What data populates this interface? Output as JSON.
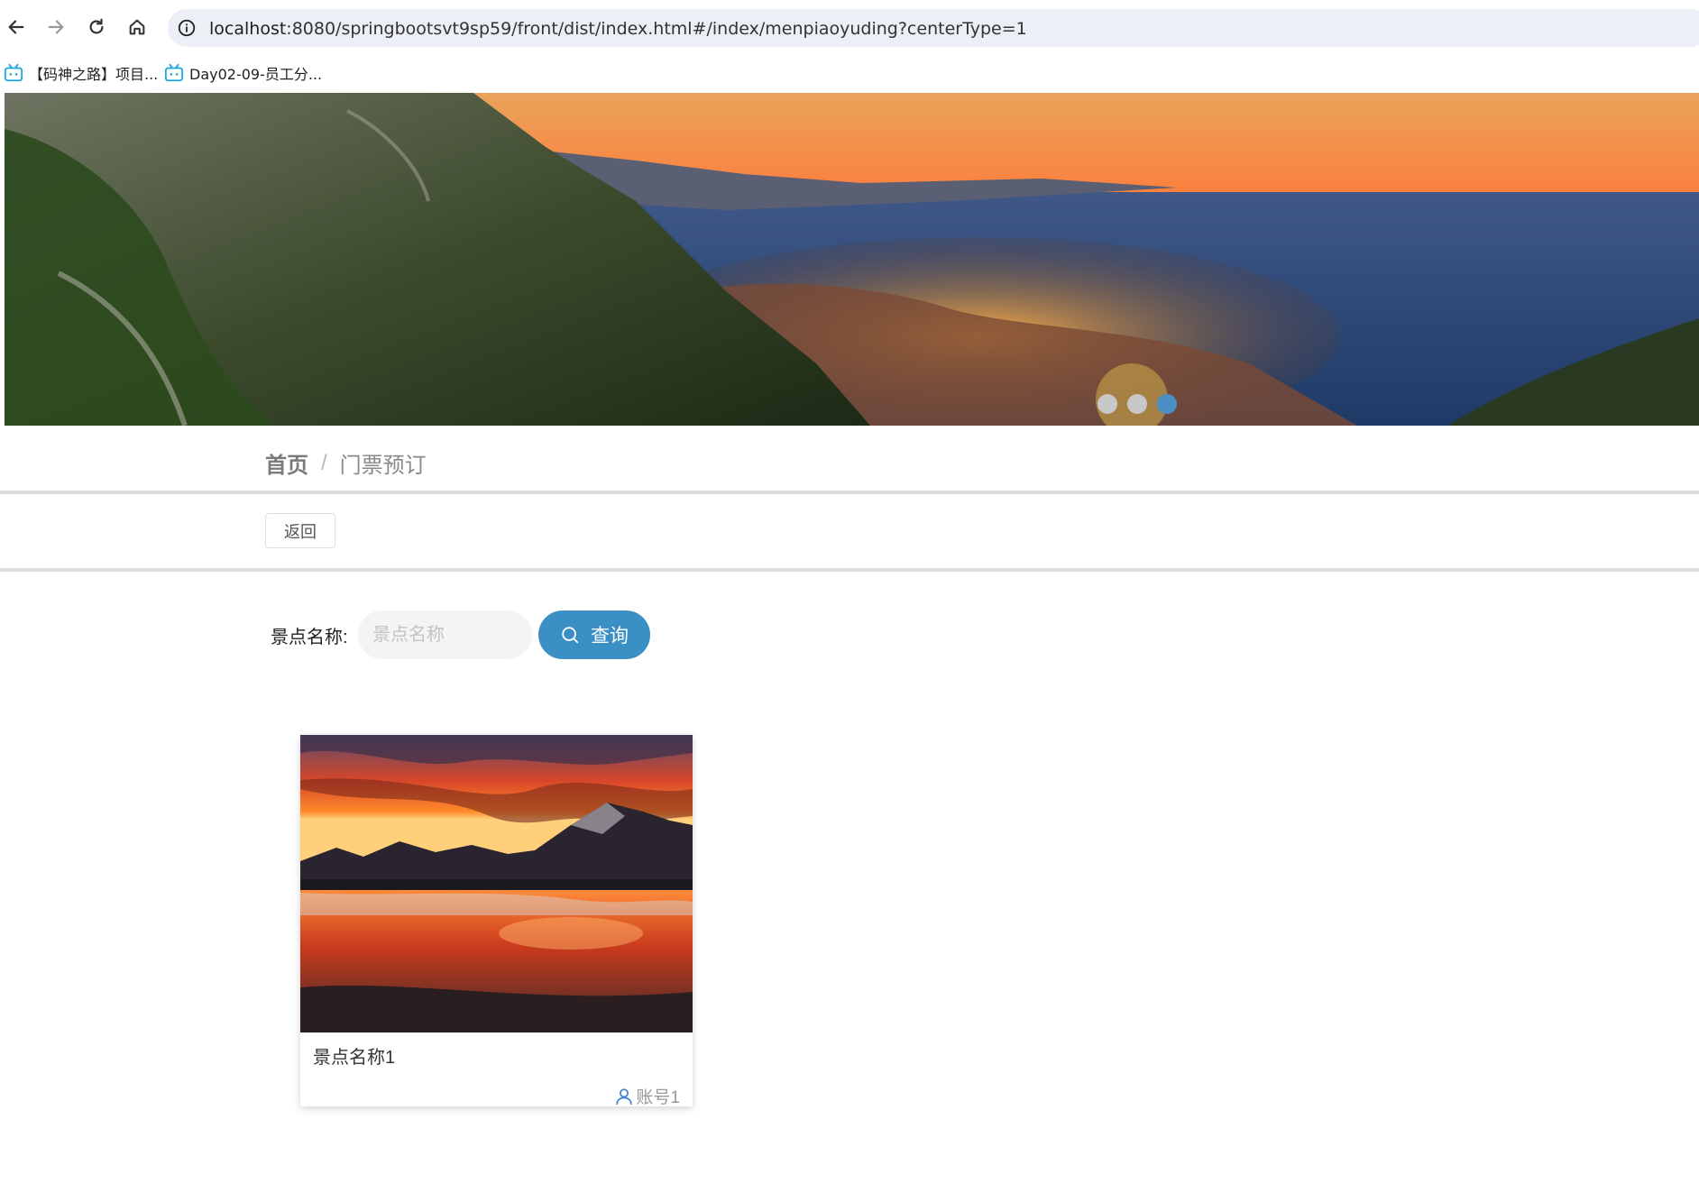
{
  "browser": {
    "url_host": "localhost",
    "url_rest": ":8080/springbootsvt9sp59/front/dist/index.html#/index/menpiaoyuding?centerType=1",
    "bookmarks": [
      {
        "label": "【码神之路】项目...",
        "icon": "bilibili-icon"
      },
      {
        "label": "Day02-09-员工分...",
        "icon": "bilibili-icon"
      }
    ]
  },
  "carousel": {
    "slides": 3,
    "active_index": 3
  },
  "breadcrumb": {
    "home": "首页",
    "separator": "/",
    "current": "门票预订"
  },
  "actions": {
    "back_label": "返回"
  },
  "search": {
    "label": "景点名称:",
    "placeholder": "景点名称",
    "value": "",
    "button_label": "查询"
  },
  "cards": [
    {
      "title": "景点名称1",
      "account": "账号1",
      "account_icon": "user-icon"
    }
  ],
  "colors": {
    "accent": "#3a8fc4",
    "dot_active": "#4b8fc4",
    "dot_inactive": "#c8c8c8"
  }
}
